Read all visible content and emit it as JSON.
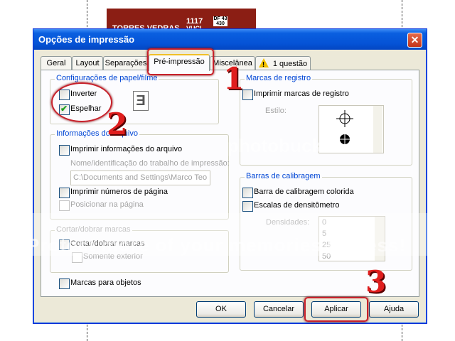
{
  "background": {
    "banner_text_1": "TORRES VEDRAS",
    "banner_text_2": "1117",
    "banner_text_3": "VUCI",
    "banner_box": "DF 43 430"
  },
  "dialog": {
    "title": "Opções de impressão",
    "close_icon": "close-icon",
    "tabs": [
      {
        "label": "Geral"
      },
      {
        "label": "Layout"
      },
      {
        "label": "Separações"
      },
      {
        "label": "Pré-impressão",
        "active": true
      },
      {
        "label": "Miscelânea"
      },
      {
        "label": "1 questão",
        "icon": "warning-icon"
      }
    ],
    "paper_film": {
      "title": "Configurações de papel/filme",
      "invert": {
        "label": "Inverter",
        "checked": false
      },
      "mirror": {
        "label": "Espelhar",
        "checked": true
      },
      "preview_glyph": "Ǝ"
    },
    "file_info": {
      "title": "Informações do arquivo",
      "print_file_info": {
        "label": "Imprimir informações do arquivo",
        "checked": false
      },
      "job_name_label": "Nome/identificação do trabalho de impressão:",
      "job_name_value": "C:\\Documents and Settings\\Marco Teo",
      "print_page_numbers": {
        "label": "Imprimir números de página",
        "checked": false
      },
      "position_on_page": {
        "label": "Posicionar na página",
        "checked": false
      }
    },
    "crop_marks": {
      "title": "Cortar/dobrar marcas",
      "crop_fold": {
        "label": "Cortar/dobrar marcas",
        "checked": false
      },
      "exterior_only": {
        "label": "Somente exterior",
        "checked": false
      }
    },
    "object_marks": {
      "label": "Marcas para objetos",
      "checked": false
    },
    "registration": {
      "title": "Marcas de registro",
      "print_registration": {
        "label": "Imprimir marcas de registro",
        "checked": false
      },
      "style_label": "Estilo:"
    },
    "calibration": {
      "title": "Barras de calibragem",
      "color_bar": {
        "label": "Barra de calibragem colorida",
        "checked": false
      },
      "densitometer": {
        "label": "Escalas de densitômetro",
        "checked": false
      },
      "densities_label": "Densidades:",
      "densities": [
        "0",
        "5",
        "25",
        "50"
      ]
    },
    "buttons": {
      "ok": "OK",
      "cancel": "Cancelar",
      "apply": "Aplicar",
      "help": "Ajuda"
    }
  },
  "annotations": {
    "step1": "1",
    "step2": "2",
    "step3": "3",
    "color": "#c7202a"
  },
  "watermark": {
    "line1": "photobucket",
    "line2": "Protect more of your memories for less!"
  }
}
